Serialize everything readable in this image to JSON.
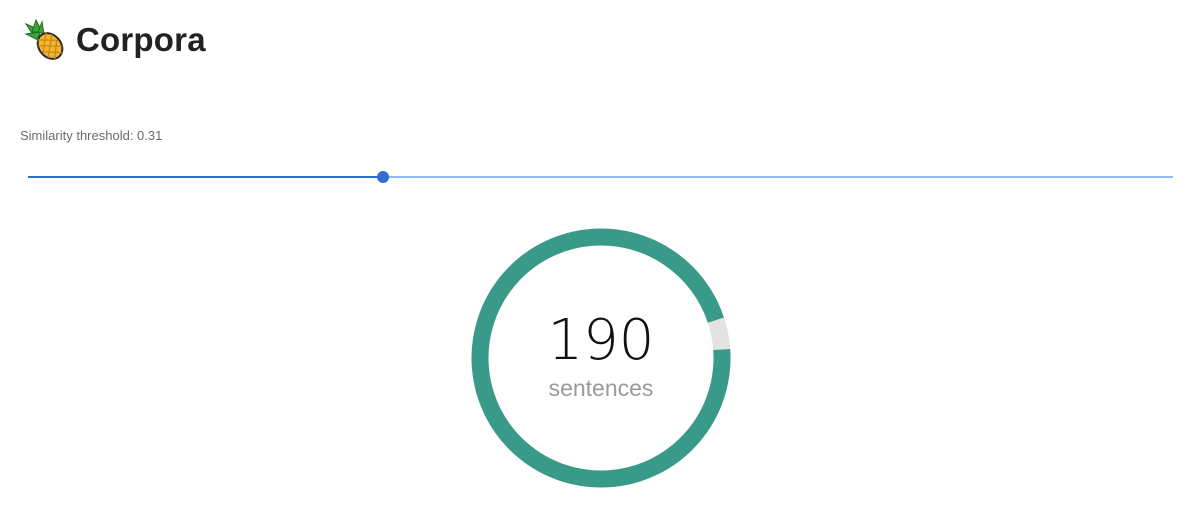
{
  "app": {
    "title": "Corpora",
    "logo_icon": "pineapple-icon"
  },
  "slider": {
    "label": "Similarity threshold: 0.31",
    "value": 0.31,
    "min": 0,
    "max": 1,
    "track_color": "#2f6fd1",
    "rail_color": "#90bdf0"
  },
  "gauge": {
    "value": "190",
    "unit": "sentences",
    "fill_fraction": 0.96,
    "fill_color": "#3a9a8a",
    "track_color": "#e3e3e3"
  }
}
